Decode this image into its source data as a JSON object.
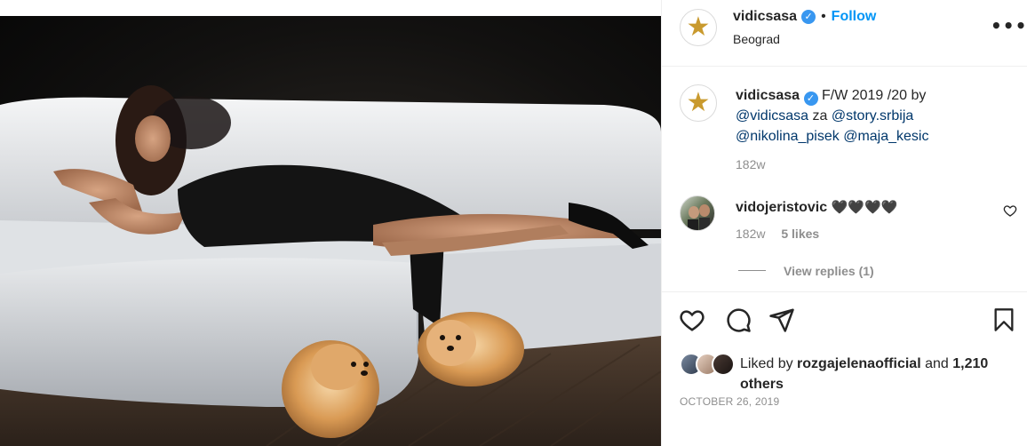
{
  "post": {
    "author": "vidicsasa",
    "separator": "•",
    "follow_label": "Follow",
    "location": "Beograd",
    "more_label": "•••"
  },
  "caption": {
    "author": "vidicsasa",
    "text_start": "F/W 2019 /20 by",
    "mention1": "@vidicsasa",
    "word_za": "za",
    "mention2": "@story.srbija",
    "mention3": "@nikolina_pisek",
    "mention4": "@maja_kesic",
    "time": "182w"
  },
  "comment": {
    "author": "vidojeristovic",
    "text": "🖤🖤🖤🖤",
    "time": "182w",
    "likes": "5 likes",
    "view_replies": "View replies (1)"
  },
  "likes": {
    "prefix": "Liked by",
    "user": "rozgajelenaofficial",
    "middle": "and",
    "count": "1,210",
    "suffix": "others"
  },
  "date": "OCTOBER 26, 2019",
  "icons": {
    "like": "heart-icon",
    "comment": "comment-icon",
    "share": "paper-plane-icon",
    "save": "bookmark-icon",
    "verified": "verified-badge-icon",
    "more": "more-options-icon"
  },
  "colors": {
    "link": "#0095f6",
    "mention": "#00376b",
    "verified": "#3897f0",
    "muted": "#8e8e8e",
    "text": "#262626"
  }
}
